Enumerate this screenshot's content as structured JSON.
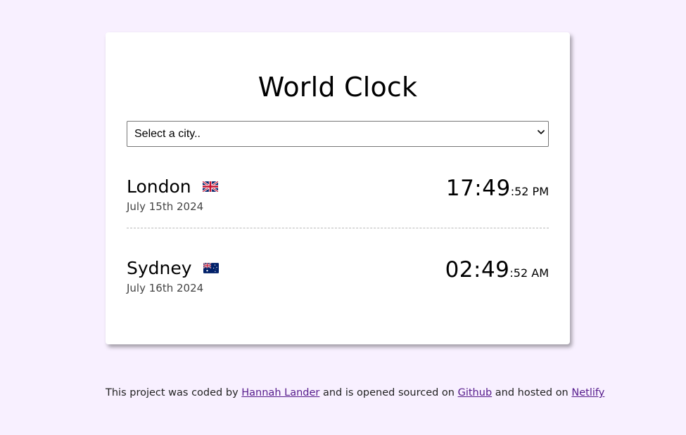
{
  "app": {
    "title": "World Clock"
  },
  "city_select": {
    "selected_label": "Select a city..",
    "options": [
      "Select a city.."
    ]
  },
  "cities": [
    {
      "name": "London",
      "flag": "uk-flag-icon",
      "date": "July 15th 2024",
      "time_main": "17:49",
      "time_rest": ":52 PM"
    },
    {
      "name": "Sydney",
      "flag": "australia-flag-icon",
      "date": "July 16th 2024",
      "time_main": "02:49",
      "time_rest": ":52 AM"
    }
  ],
  "footer": {
    "text1": "This project was coded by ",
    "author_link": "Hannah Lander",
    "text2": " and is opened sourced on ",
    "github_link": "Github",
    "text3": " and hosted on ",
    "netlify_link": "Netlify"
  },
  "colors": {
    "page_background": "#f8f0ff",
    "card_background": "#ffffff",
    "link_visited": "#551a8b"
  }
}
